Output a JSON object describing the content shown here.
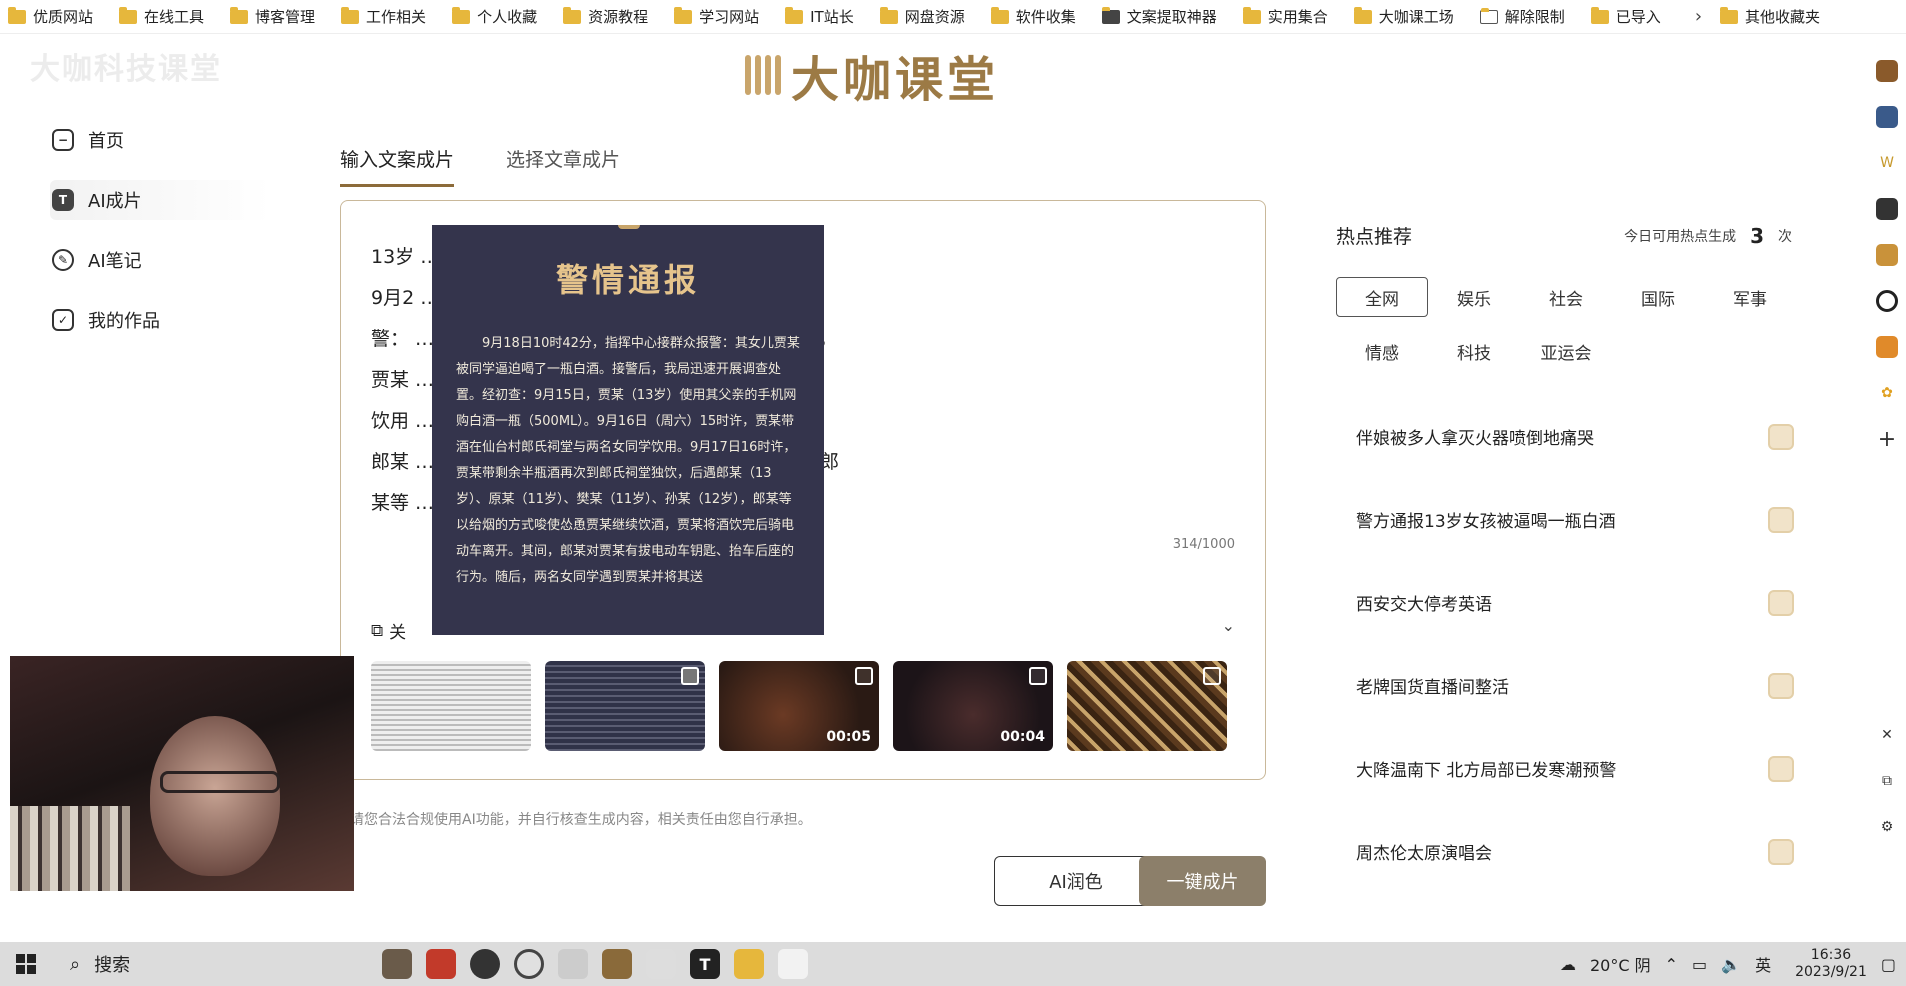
{
  "bookmarks": {
    "items": [
      "优质网站",
      "在线工具",
      "博客管理",
      "工作相关",
      "个人收藏",
      "资源教程",
      "学习网站",
      "IT站长",
      "网盘资源",
      "软件收集",
      "文案提取神器",
      "实用集合",
      "大咖课工场",
      "解除限制",
      "已导入"
    ],
    "more": "其他收藏夹"
  },
  "header": {
    "watermark": "大咖科技课堂",
    "logo_text": "大咖课堂"
  },
  "sidebar": {
    "items": [
      {
        "label": "首页",
        "icon": "home-icon"
      },
      {
        "label": "AI成片",
        "icon": "t-icon"
      },
      {
        "label": "AI笔记",
        "icon": "note-icon"
      },
      {
        "label": "我的作品",
        "icon": "check-icon"
      }
    ]
  },
  "tabs": {
    "input_text": "输入文案成片",
    "select_article": "选择文章成片"
  },
  "editor": {
    "lines": [
      "13岁 …… 堂里。",
      "9月2 …… ，9月18日10时42分，指挥中心接群众报",
      "警： …… 介休市公安局迅速开展调查处置。9月15日，",
      "贾某 …… ，贾某带酒在仙台村郎氏祠堂与两名女同学",
      "饮用 …… 祠堂独饮，后遇郎某、原某、樊某、孙某，",
      "郎某 …… 酒饮完后骑电动车离开。介休市公安局已对郎",
      "某等 …… 一步调查办理中。"
    ],
    "counter": "314/1000",
    "related_label": "关",
    "thumbs": [
      {
        "duration": "",
        "checked": false,
        "has_check": false
      },
      {
        "duration": "",
        "checked": true,
        "has_check": true
      },
      {
        "duration": "00:05",
        "checked": false,
        "has_check": true
      },
      {
        "duration": "00:04",
        "checked": false,
        "has_check": true
      },
      {
        "duration": "",
        "checked": false,
        "has_check": true
      }
    ]
  },
  "notice": {
    "title": "警情通报",
    "body": "9月18日10时42分，指挥中心接群众报警：其女儿贾某被同学逼迫喝了一瓶白酒。接警后，我局迅速开展调查处置。经初查：9月15日，贾某（13岁）使用其父亲的手机网购白酒一瓶（500ML）。9月16日（周六）15时许，贾某带酒在仙台村郎氏祠堂与两名女同学饮用。9月17日16时许，贾某带剩余半瓶酒再次到郎氏祠堂独饮，后遇郎某（13岁）、原某（11岁）、樊某（11岁）、孙某（12岁），郎某等以给烟的方式唆使怂恿贾某继续饮酒，贾某将酒饮完后骑电动车离开。其间，郎某对贾某有拔电动车钥匙、抬车后座的行为。随后，两名女同学遇到贾某并将其送"
  },
  "disclaimer": "请您合法合规使用AI功能，并自行核查生成内容，相关责任由您自行承担。",
  "buttons": {
    "polish": "AI润色",
    "make": "一键成片"
  },
  "hot": {
    "title": "热点推荐",
    "quota_label": "今日可用热点生成",
    "quota_value": "3",
    "quota_unit": "次",
    "categories": [
      "全网",
      "娱乐",
      "社会",
      "国际",
      "军事",
      "情感",
      "科技",
      "亚运会"
    ],
    "topics": [
      "伴娘被多人拿灭火器喷倒地痛哭",
      "警方通报13岁女孩被逼喝一瓶白酒",
      "西安交大停考英语",
      "老牌国货直播间整活",
      "大降温南下 北方局部已发寒潮预警",
      "周杰伦太原演唱会"
    ]
  },
  "taskbar": {
    "search": "搜索",
    "weather": "20°C 阴",
    "ime": "英",
    "time": "16:36",
    "date": "2023/9/21"
  },
  "colors": {
    "accent": "#8c6b3a",
    "button_primary": "#8c7f6a",
    "notice_bg": "#34344c",
    "notice_title": "#e6c48c"
  }
}
